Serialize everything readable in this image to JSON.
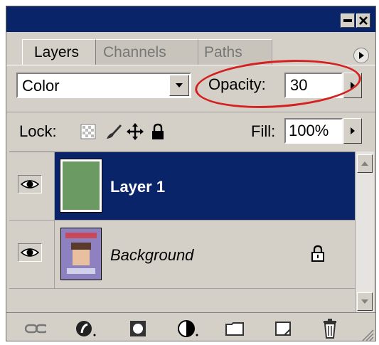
{
  "tabs": [
    {
      "label": "Layers",
      "active": true
    },
    {
      "label": "Channels",
      "active": false
    },
    {
      "label": "Paths",
      "active": false
    }
  ],
  "blend_mode": {
    "value": "Color"
  },
  "opacity": {
    "label": "Opacity:",
    "value": "30"
  },
  "lock": {
    "label": "Lock:"
  },
  "fill": {
    "label": "Fill:",
    "value": "100%"
  },
  "layers": [
    {
      "name": "Layer 1",
      "selected": true,
      "visible": true,
      "locked": false
    },
    {
      "name": "Background",
      "selected": false,
      "visible": true,
      "locked": true
    }
  ],
  "colors": {
    "titlebar": "#0a246a",
    "selected_row": "#0a246a",
    "panel": "#d4d0c8",
    "highlight_circle": "#d42020"
  },
  "icons": [
    "minimize-icon",
    "close-icon",
    "panel-menu-icon",
    "lock-transparency-icon",
    "lock-brush-icon",
    "lock-move-icon",
    "lock-all-icon",
    "eye-icon",
    "link-icon",
    "layer-style-icon",
    "layer-mask-icon",
    "adjustment-layer-icon",
    "layer-set-icon",
    "new-layer-icon",
    "trash-icon"
  ]
}
